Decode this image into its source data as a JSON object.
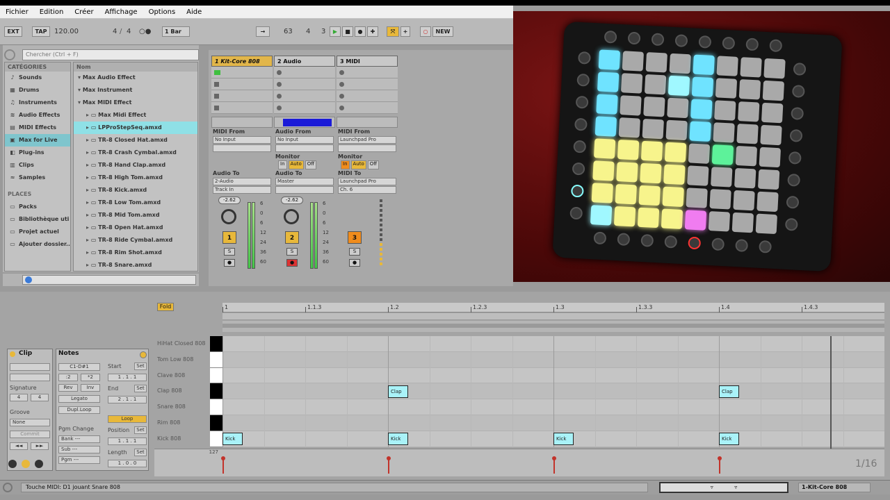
{
  "menu": [
    "Fichier",
    "Edition",
    "Créer",
    "Affichage",
    "Options",
    "Aide"
  ],
  "transport": {
    "ext": "EXT",
    "tap": "TAP",
    "tempo": "120.00",
    "sig_num": "4",
    "sig_den": "4",
    "quant": "1 Bar",
    "pos_bar": "63",
    "pos_beat": "4",
    "pos_sixteenth": "3",
    "new": "NEW"
  },
  "browser": {
    "search_placeholder": "Chercher (Ctrl + F)",
    "categories_header": "CATÉGORIES",
    "name_header": "Nom",
    "categories": [
      {
        "label": "Sounds",
        "icon": "♪"
      },
      {
        "label": "Drums",
        "icon": "▦"
      },
      {
        "label": "Instruments",
        "icon": "♫"
      },
      {
        "label": "Audio Effects",
        "icon": "≋"
      },
      {
        "label": "MIDI Effects",
        "icon": "▤"
      },
      {
        "label": "Max for Live",
        "icon": "▣"
      },
      {
        "label": "Plug-ins",
        "icon": "◧"
      },
      {
        "label": "Clips",
        "icon": "▥"
      },
      {
        "label": "Samples",
        "icon": "≈"
      }
    ],
    "places_header": "PLACES",
    "places": [
      "Packs",
      "Bibliothèque uti",
      "Projet actuel",
      "Ajouter dossier..."
    ],
    "items": [
      {
        "label": "Max Audio Effect",
        "indent": 0
      },
      {
        "label": "Max Instrument",
        "indent": 0
      },
      {
        "label": "Max MIDI Effect",
        "indent": 0
      },
      {
        "label": "Max Midi Effect",
        "indent": 1
      },
      {
        "label": "LPProStepSeq.amxd",
        "indent": 1
      },
      {
        "label": "TR-8 Closed Hat.amxd",
        "indent": 1
      },
      {
        "label": "TR-8 Crash Cymbal.amxd",
        "indent": 1
      },
      {
        "label": "TR-8 Hand Clap.amxd",
        "indent": 1
      },
      {
        "label": "TR-8 High Tom.amxd",
        "indent": 1
      },
      {
        "label": "TR-8 Kick.amxd",
        "indent": 1
      },
      {
        "label": "TR-8 Low Tom.amxd",
        "indent": 1
      },
      {
        "label": "TR-8 Mid Tom.amxd",
        "indent": 1
      },
      {
        "label": "TR-8 Open Hat.amxd",
        "indent": 1
      },
      {
        "label": "TR-8 Ride Cymbal.amxd",
        "indent": 1
      },
      {
        "label": "TR-8 Rim Shot.amxd",
        "indent": 1
      },
      {
        "label": "TR-8 Snare.amxd",
        "indent": 1
      }
    ]
  },
  "session": {
    "tracks": [
      {
        "name": "1 Kit-Core 808",
        "num": "1",
        "color": "#e8b83a",
        "midi_from_label": "MIDI From",
        "midi_from": "No Input",
        "audio_to_label": "Audio To",
        "audio_to": "2-Audio",
        "audio_to2": "Track In",
        "vol": "-2.62"
      },
      {
        "name": "2 Audio",
        "num": "2",
        "color": "#e8b83a",
        "midi_from_label": "Audio From",
        "midi_from": "No Input",
        "audio_to_label": "Audio To",
        "audio_to": "Master",
        "audio_to2": "",
        "vol": "-2.62"
      },
      {
        "name": "3 MIDI",
        "num": "3",
        "color": "#f08c1c",
        "midi_from_label": "MIDI From",
        "midi_from": "Launchpad Pro",
        "audio_to_label": "MIDI To",
        "audio_to": "Launchpad Pro",
        "audio_to2": "Ch. 6",
        "vol": ""
      }
    ],
    "monitor_label": "Monitor",
    "monitor_opts": [
      "In",
      "Auto",
      "Off"
    ],
    "meter_scale": [
      "6",
      "0",
      "6",
      "12",
      "24",
      "36",
      "60"
    ]
  },
  "detail": {
    "fold": "Fold",
    "clip_title": "Clip",
    "notes_title": "Notes",
    "signature_label": "Signature",
    "sig_num": "4",
    "sig_den": "4",
    "groove_label": "Groove",
    "groove_value": "None",
    "commit": "Commit",
    "notes_range": "C1-D#1",
    "rev": "Rev",
    "inv": "Inv",
    "legato": "Legato",
    "dupl": "Dupl.Loop",
    "pgm_label": "Pgm Change",
    "bank": "Bank ---",
    "sub": "Sub ---",
    "pgm": "Pgm ---",
    "start_label": "Start",
    "end_label": "End",
    "loop_label": "Loop",
    "position_label": "Position",
    "length_label": "Length",
    "set": "Set",
    "ruler": [
      "1",
      "1.1.3",
      "1.2",
      "1.2.3",
      "1.3",
      "1.3.3",
      "1.4",
      "1.4.3"
    ],
    "keys": [
      "HiHat Closed 808",
      "Tom Low 808",
      "Clave 808",
      "Clap 808",
      "Snare 808",
      "Rim 808",
      "Kick 808"
    ],
    "notes": [
      {
        "lane": 3,
        "step": 4,
        "label": "Clap"
      },
      {
        "lane": 3,
        "step": 12,
        "label": "Clap"
      },
      {
        "lane": 6,
        "step": 0,
        "label": "Kick"
      },
      {
        "lane": 6,
        "step": 4,
        "label": "Kick"
      },
      {
        "lane": 6,
        "step": 8,
        "label": "Kick"
      },
      {
        "lane": 6,
        "step": 12,
        "label": "Kick"
      }
    ],
    "velocity_max": "127",
    "velocity_steps": [
      0,
      4,
      8,
      12
    ],
    "grid_readout": "1/16"
  },
  "status": {
    "message": "Touche MIDI: D1 jouant Snare 808",
    "track": "1-Kit-Core 808"
  },
  "colors": {
    "accent": "#e8b83a",
    "note": "#a9f2f8",
    "selection": "#7fc5cd"
  }
}
